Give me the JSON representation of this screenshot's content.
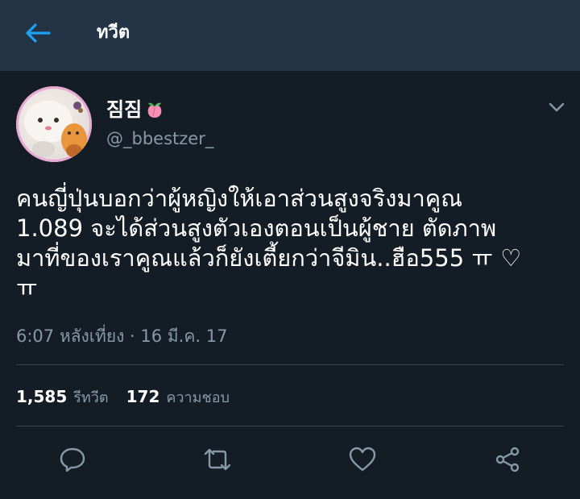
{
  "header": {
    "title": "ทวีต"
  },
  "tweet": {
    "display_name": "짐짐",
    "handle": "@_bbestzer_",
    "text": "คนญี่ปุ่นบอกว่าผู้หญิงให้เอาส่วนสูงจริงมาคูณ\n1.089 จะได้ส่วนสูงตัวเองตอนเป็นผู้ชาย ตัดภาพ\nมาที่ของเราคูณแล้วก็ยังเตี้ยกว่าจีมิน..ฮือ555 ㅠ ♡\nㅠ",
    "timestamp": "6:07 หลังเที่ยง · 16 มี.ค. 17"
  },
  "stats": {
    "retweets_count": "1,585",
    "retweets_label": "รีทวีต",
    "likes_count": "172",
    "likes_label": "ความชอบ"
  },
  "actions": [
    "reply-icon",
    "retweet-icon",
    "like-icon",
    "share-icon"
  ],
  "colors": {
    "background": "#141d26",
    "header": "#243447",
    "accent": "#1da1f2",
    "muted": "#8899a6",
    "divider": "#38444d"
  }
}
